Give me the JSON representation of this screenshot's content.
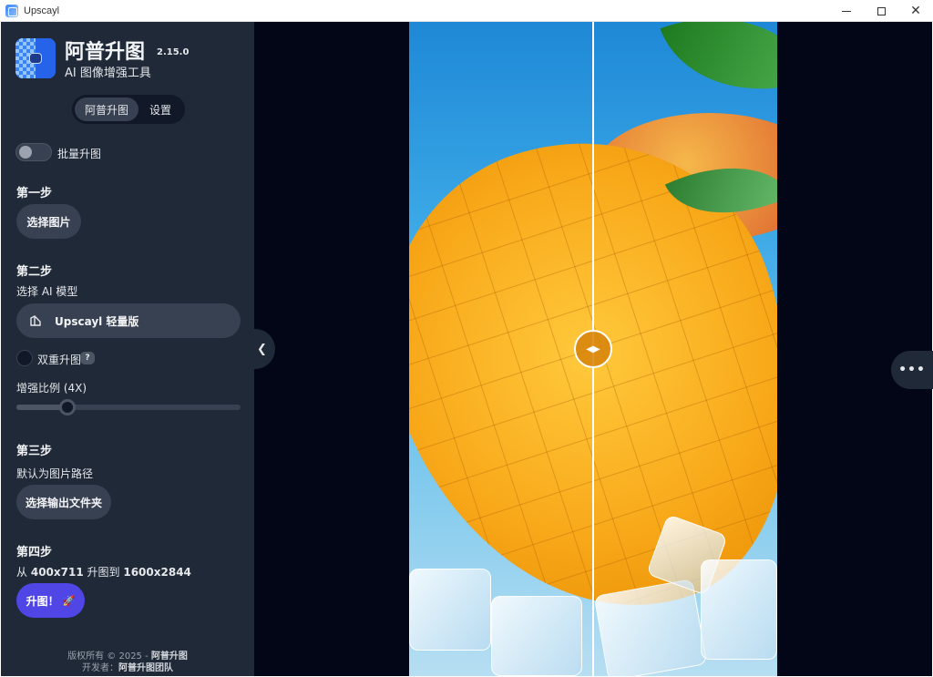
{
  "window": {
    "title": "Upscayl",
    "minimize_icon": "minimize-icon",
    "maximize_icon": "maximize-icon",
    "close_icon": "close-icon"
  },
  "sidebar": {
    "app_name": "阿普升图",
    "version": "2.15.0",
    "subtitle": "AI 图像增强工具",
    "tabs": [
      {
        "label": "阿普升图",
        "active": true
      },
      {
        "label": "设置",
        "active": false
      }
    ],
    "batch_toggle": {
      "label": "批量升图",
      "on": false
    },
    "step1": {
      "title": "第一步",
      "button": "选择图片"
    },
    "step2": {
      "title": "第二步",
      "model_label": "选择 AI 模型",
      "model_value": "Upscayl 轻量版",
      "double_label": "双重升图",
      "help": "?",
      "scale_label": "增强比例 (4X)",
      "scale_value": 4
    },
    "step3": {
      "title": "第三步",
      "path_text": "默认为图片路径",
      "button": "选择输出文件夹"
    },
    "step4": {
      "title": "第四步",
      "from_prefix": "从",
      "from_size": "400x711",
      "to_text": "升图到",
      "to_size": "1600x2844",
      "button": "升图！",
      "button_icon": "rocket-icon"
    },
    "footer": {
      "copyright": "版权所有 © 2025 - ",
      "copyright_owner": "阿普升图",
      "dev_prefix": "开发者：",
      "dev_name": "阿普升图团队"
    }
  },
  "main": {
    "collapse_icon": "chevron-left-icon",
    "more_icon": "more-horizontal-icon",
    "compare_icon": "compare-arrows-icon",
    "compare_position": 0.5
  }
}
